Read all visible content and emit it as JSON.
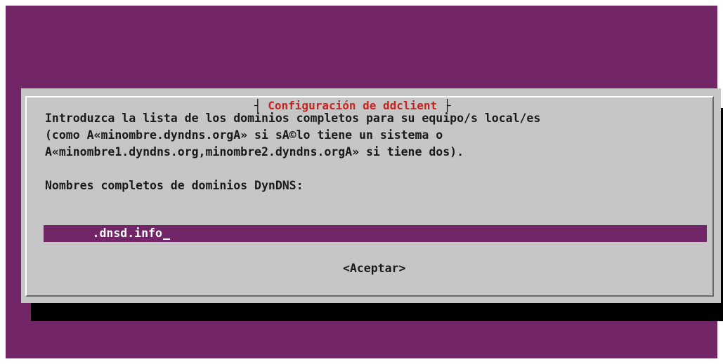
{
  "dialog": {
    "title": "Configuración de ddclient",
    "description_lines": [
      "Introduzca la lista de los dominios completos para su equipo/s local/es",
      "(como A«minombre.dyndns.orgA» si sA©lo tiene un sistema o",
      "A«minombre1.dyndns.org,minombre2.dyndns.orgA» si tiene dos)."
    ],
    "field_label": "Nombres completos de dominios DynDNS:",
    "field_value": "       .dnsd.info",
    "accept_button": "<Aceptar>"
  },
  "colors": {
    "background": "#722567",
    "dialog": "#c6c6c6",
    "title": "#c8231e",
    "input": "#722567"
  }
}
